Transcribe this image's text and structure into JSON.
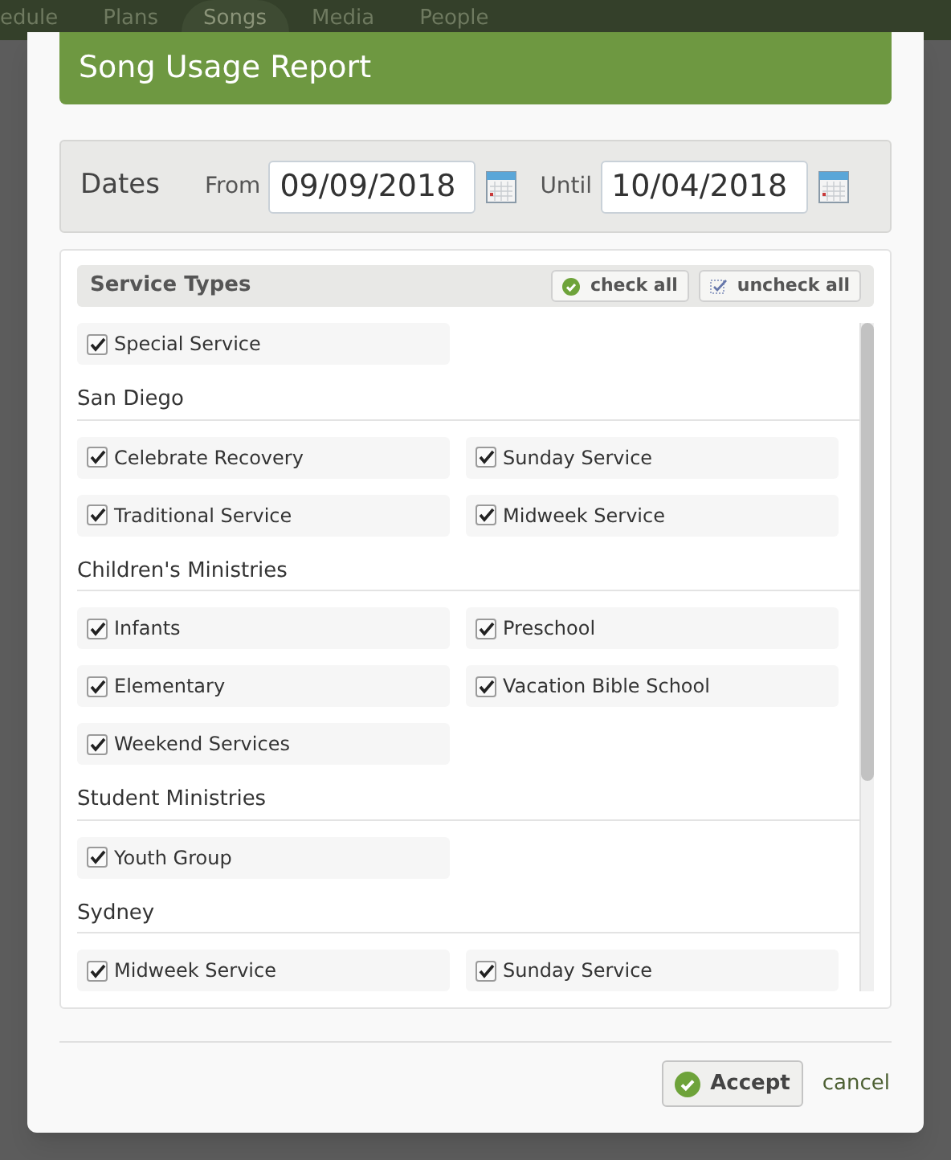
{
  "nav": {
    "items": [
      {
        "label": "edule",
        "selected": false
      },
      {
        "label": "Plans",
        "selected": false
      },
      {
        "label": "Songs",
        "selected": true
      },
      {
        "label": "Media",
        "selected": false
      },
      {
        "label": "People",
        "selected": false
      }
    ]
  },
  "dialog": {
    "title": "Song Usage Report",
    "dates": {
      "label": "Dates",
      "from": {
        "label": "From",
        "value": "09/09/2018"
      },
      "until": {
        "label": "Until",
        "value": "10/04/2018"
      }
    },
    "service_types": {
      "title": "Service Types",
      "check_all": "check all",
      "uncheck_all": "uncheck all",
      "groups": [
        {
          "items": [
            {
              "label": "Special Service",
              "checked": true
            }
          ]
        },
        {
          "name": "San Diego",
          "items": [
            {
              "label": "Celebrate Recovery",
              "checked": true
            },
            {
              "label": "Sunday Service",
              "checked": true
            },
            {
              "label": "Traditional Service",
              "checked": true
            },
            {
              "label": "Midweek Service",
              "checked": true
            }
          ]
        },
        {
          "name": "Children's Ministries",
          "items": [
            {
              "label": "Infants",
              "checked": true
            },
            {
              "label": "Preschool",
              "checked": true
            },
            {
              "label": "Elementary",
              "checked": true
            },
            {
              "label": "Vacation Bible School",
              "checked": true
            },
            {
              "label": "Weekend Services",
              "checked": true
            }
          ]
        },
        {
          "name": "Student Ministries",
          "items": [
            {
              "label": "Youth Group",
              "checked": true
            }
          ]
        },
        {
          "name": "Sydney",
          "items": [
            {
              "label": "Midweek Service",
              "checked": true
            },
            {
              "label": "Sunday Service",
              "checked": true
            }
          ]
        }
      ]
    },
    "accept": "Accept",
    "cancel": "cancel"
  }
}
